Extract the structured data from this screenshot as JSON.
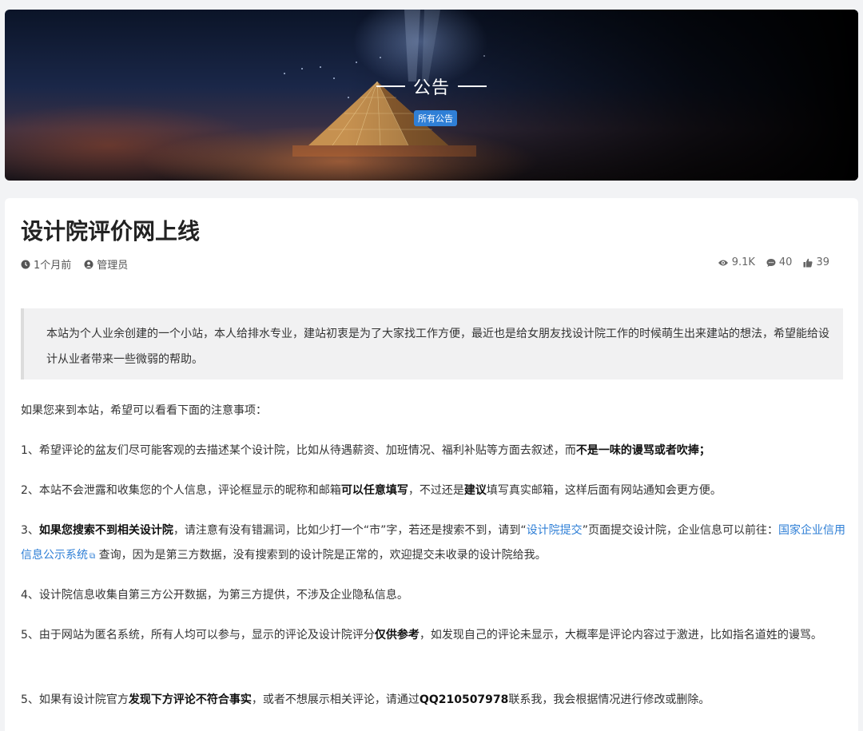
{
  "banner": {
    "title": "公告",
    "tag": "所有公告"
  },
  "post": {
    "title": "设计院评价网上线",
    "time": "1个月前",
    "author": "管理员",
    "views": "9.1K",
    "comments": "40",
    "likes": "39"
  },
  "quote": "本站为个人业余创建的一个小站，本人给排水专业，建站初衷是为了大家找工作方便，最近也是给女朋友找设计院工作的时候萌生出来建站的想法，希望能给设计从业者带来一些微弱的帮助。",
  "intro": "如果您来到本站，希望可以看看下面的注意事项：",
  "items": {
    "i1_a": "1、希望评论的盆友们尽可能客观的去描述某个设计院，比如从待遇薪资、加班情况、福利补贴等方面去叙述，而",
    "i1_b": "不是一味的谩骂或者吹捧；",
    "i2_a": "2、本站不会泄露和收集您的个人信息，评论框显示的昵称和邮箱",
    "i2_b": "可以任意填写",
    "i2_c": "，不过还是",
    "i2_d": "建议",
    "i2_e": "填写真实邮箱，这样后面有网站通知会更方便。",
    "i3_a": "3、",
    "i3_b": "如果您搜索不到相关设计院",
    "i3_c": "，请注意有没有错漏词，比如少打一个“市”字，若还是搜索不到，请到“",
    "i3_link1": "设计院提交",
    "i3_d": "”页面提交设计院，企业信息可以前往：",
    "i3_link2": "国家企业信用信息公示系统",
    "i3_e": " 查询，因为是第三方数据，没有搜索到的设计院是正常的，欢迎提交未收录的设计院给我。",
    "i4": "4、设计院信息收集自第三方公开数据，为第三方提供，不涉及企业隐私信息。",
    "i5_a": "5、由于网站为匿名系统，所有人均可以参与，显示的评论及设计院评分",
    "i5_b": "仅供参考",
    "i5_c": "，如发现自己的评论未显示，大概率是评论内容过于激进，比如指名道姓的谩骂。",
    "i6_a": "5、如果有设计院官方",
    "i6_b": "发现下方评论不符合事实",
    "i6_c": "，或者不想展示相关评论，请通过",
    "i6_d": "QQ210507978",
    "i6_e": "联系我，我会根据情况进行修改或删除。"
  },
  "icons": {
    "time": "clock-icon",
    "author": "user-icon",
    "views": "eye-icon",
    "comments": "comment-icon",
    "likes": "thumbs-up-icon",
    "external": "external-link-icon"
  },
  "colors": {
    "link": "#2f7fd6",
    "tag_bg": "#2f7fd6"
  }
}
